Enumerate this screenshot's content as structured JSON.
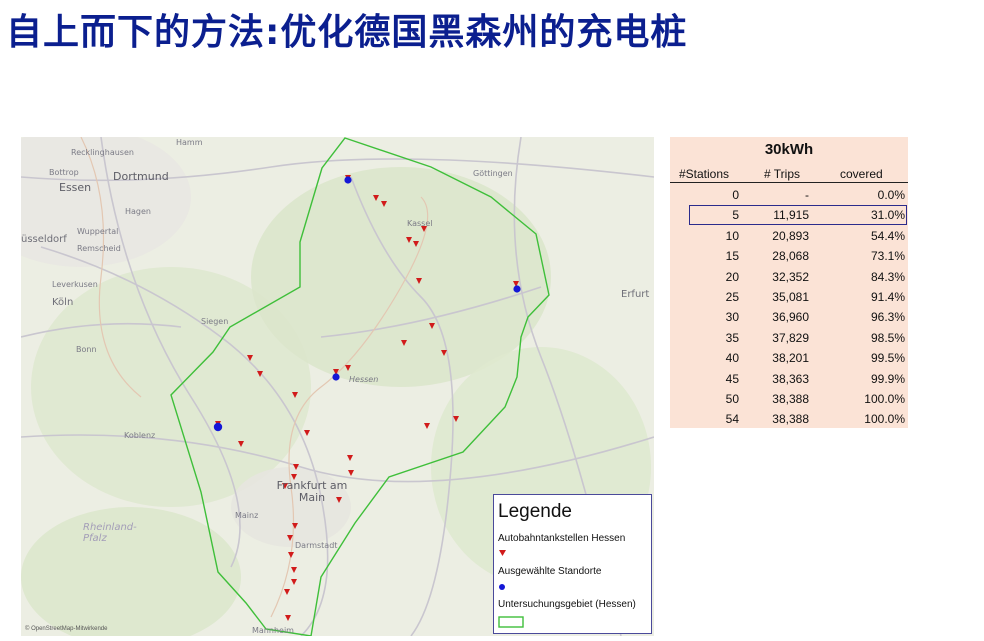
{
  "slide": {
    "title": "自上而下的方法:优化德国黑森州的充电桩"
  },
  "map": {
    "labels": {
      "dortmund": "Dortmund",
      "essen": "Essen",
      "bottrop": "Bottrop",
      "recklinghausen": "Recklinghausen",
      "hamm": "Hamm",
      "hagen": "Hagen",
      "wuppertal": "Wuppertal",
      "duesseldorf": "üsseldorf",
      "remscheid": "Remscheid",
      "koeln": "Köln",
      "leverkusen": "Leverkusen",
      "siegen": "Siegen",
      "bonn": "Bonn",
      "koblenz": "Koblenz",
      "kassel": "Kassel",
      "goettingen": "Göttingen",
      "erfurt": "Erfurt",
      "hessen": "Hessen",
      "frankfurt": "Frankfurt am Main",
      "mainz": "Mainz",
      "darmstadt": "Darmstadt",
      "rheinland": "Rheinland-Pfalz",
      "mannheim": "Mannheim"
    },
    "attribution": "© OpenStreetMap-Mitwirkende",
    "colors": {
      "boundary": "#3fbf3a",
      "station_marker": "#d11b1b",
      "selected_marker": "#1417d6"
    },
    "legend": {
      "title": "Legende",
      "item1": "Autobahntankstellen Hessen",
      "item2": "Ausgewählte Standorte",
      "item3": "Untersuchungsgebiet (Hessen)"
    }
  },
  "table": {
    "title": "30kWh",
    "col_stations": "#Stations",
    "col_trips": "# Trips",
    "col_covered": "covered",
    "rows": [
      {
        "stations": "0",
        "trips": "-",
        "covered": "0.0%"
      },
      {
        "stations": "5",
        "trips": "11,915",
        "covered": "31.0%"
      },
      {
        "stations": "10",
        "trips": "20,893",
        "covered": "54.4%"
      },
      {
        "stations": "15",
        "trips": "28,068",
        "covered": "73.1%"
      },
      {
        "stations": "20",
        "trips": "32,352",
        "covered": "84.3%"
      },
      {
        "stations": "25",
        "trips": "35,081",
        "covered": "91.4%"
      },
      {
        "stations": "30",
        "trips": "36,960",
        "covered": "96.3%"
      },
      {
        "stations": "35",
        "trips": "37,829",
        "covered": "98.5%"
      },
      {
        "stations": "40",
        "trips": "38,201",
        "covered": "99.5%"
      },
      {
        "stations": "45",
        "trips": "38,363",
        "covered": "99.9%"
      },
      {
        "stations": "50",
        "trips": "38,388",
        "covered": "100.0%"
      },
      {
        "stations": "54",
        "trips": "38,388",
        "covered": "100.0%"
      }
    ],
    "highlighted_row": "5"
  }
}
